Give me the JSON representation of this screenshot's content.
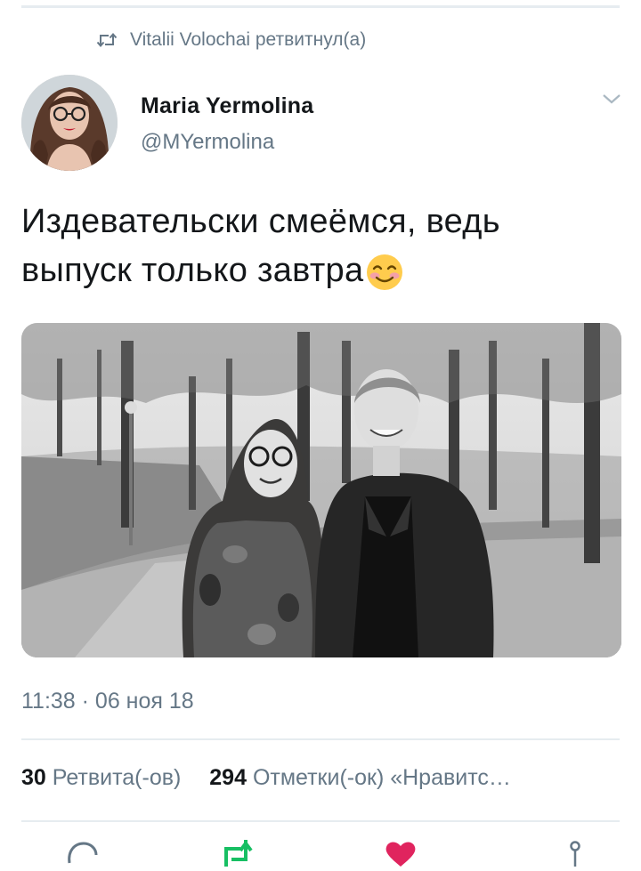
{
  "retweet": {
    "icon": "retweet-icon",
    "text": "Vitalii Volochai ретвитнул(а)"
  },
  "author": {
    "name": "Maria Yermolina",
    "handle": "@MYermolina"
  },
  "tweet": {
    "line1": "Издевательски смеёмся, ведь",
    "line2": "выпуск только завтра",
    "emoji": "smiling-face-with-smiling-eyes"
  },
  "timestamp": "11:38 · 06 ноя 18",
  "stats": {
    "retweets_count": "30",
    "retweets_label": "Ретвита(-ов)",
    "likes_count": "294",
    "likes_label": "Отметки(-ок) «Нравитс…"
  },
  "colors": {
    "secondary_text": "#657786",
    "retweet_green": "#17bf63",
    "like_red": "#e0245e",
    "divider": "#e6ecf0"
  },
  "actions": [
    "reply-icon",
    "retweet-action-icon",
    "like-icon",
    "share-icon"
  ]
}
